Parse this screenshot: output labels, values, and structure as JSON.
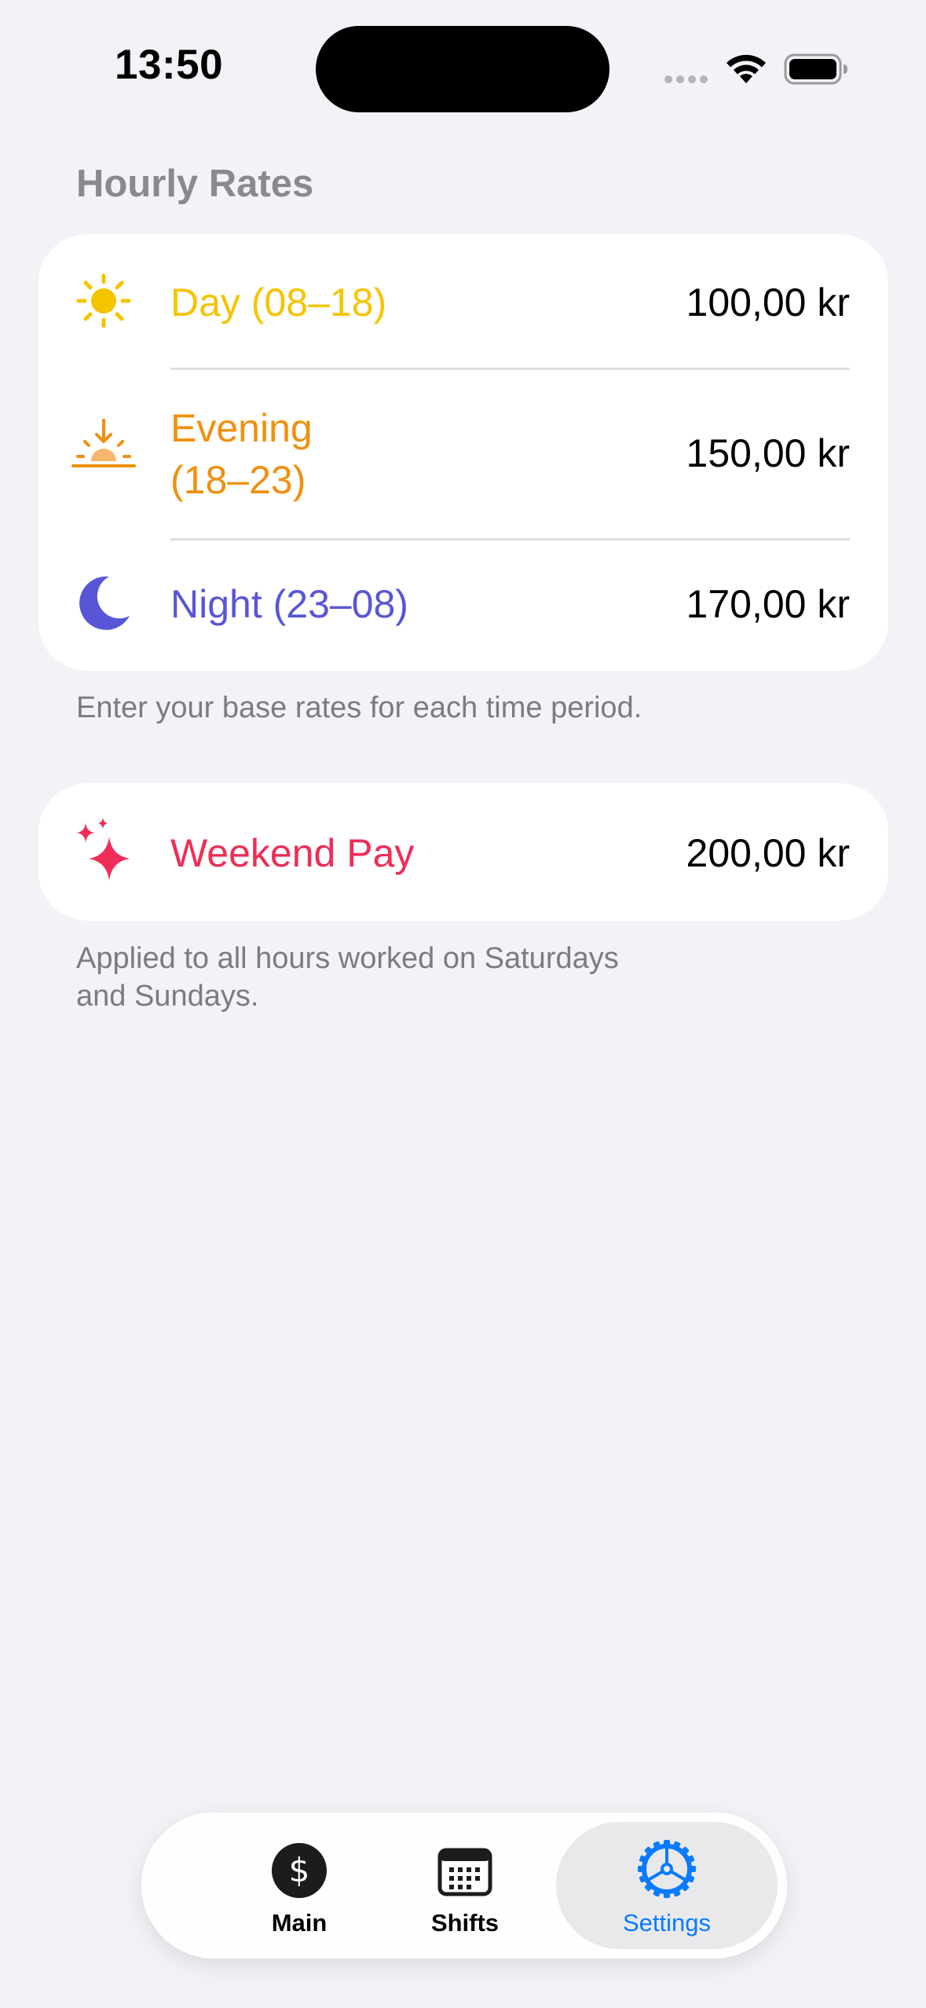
{
  "status_bar": {
    "time": "13:50"
  },
  "hourly_rates": {
    "header": "Hourly Rates",
    "rows": [
      {
        "label_line1": "Day (08–18)",
        "label_line2": "",
        "value": "100,00 kr",
        "color": "#f5c400",
        "icon": "sun-icon"
      },
      {
        "label_line1": "Evening",
        "label_line2": "(18–23)",
        "value": "150,00 kr",
        "color": "#f0900f",
        "icon": "sunset-icon"
      },
      {
        "label_line1": "Night (23–08)",
        "label_line2": "",
        "value": "170,00 kr",
        "color": "#5856d6",
        "icon": "moon-icon"
      }
    ],
    "footer": "Enter your base rates for each time period."
  },
  "weekend": {
    "label": "Weekend Pay",
    "value": "200,00 kr",
    "color": "#ef2d56",
    "icon": "sparkles-icon",
    "footer_line1": "Applied to all hours worked on Saturdays",
    "footer_line2": "and Sundays."
  },
  "tab_bar": {
    "tabs": [
      {
        "label": "Main",
        "icon": "dollar-circle-icon",
        "active": false
      },
      {
        "label": "Shifts",
        "icon": "calendar-icon",
        "active": false
      },
      {
        "label": "Settings",
        "icon": "gear-icon",
        "active": true
      }
    ],
    "accent": "#0a7aff"
  }
}
